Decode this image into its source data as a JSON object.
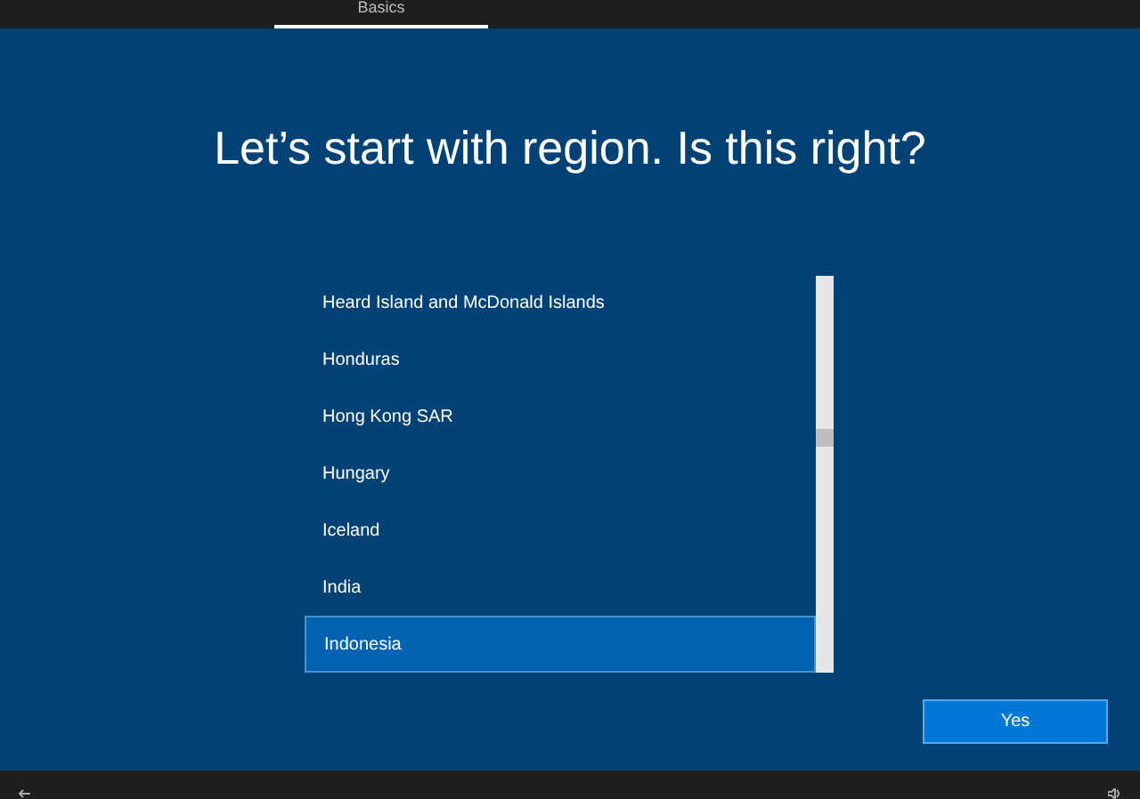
{
  "tabs": [
    {
      "label": "Basics",
      "selected": true
    }
  ],
  "title": "Let’s start with region. Is this right?",
  "regions": [
    {
      "name": "Heard Island and McDonald Islands",
      "selected": false
    },
    {
      "name": "Honduras",
      "selected": false
    },
    {
      "name": "Hong Kong SAR",
      "selected": false
    },
    {
      "name": "Hungary",
      "selected": false
    },
    {
      "name": "Iceland",
      "selected": false
    },
    {
      "name": "India",
      "selected": false
    },
    {
      "name": "Indonesia",
      "selected": true
    }
  ],
  "buttons": [
    {
      "label": "Yes"
    }
  ]
}
